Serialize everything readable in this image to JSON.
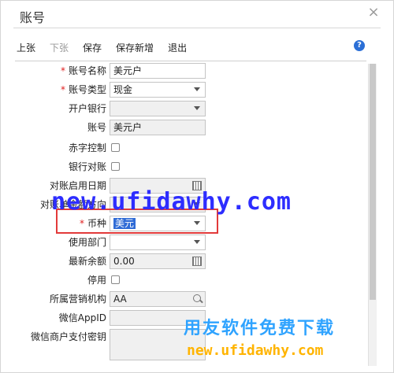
{
  "dialog": {
    "title": "账号",
    "close_glyph": "×"
  },
  "toolbar": {
    "prev": "上张",
    "next": "下张",
    "save": "保存",
    "save_new": "保存新增",
    "exit": "退出",
    "help_glyph": "?"
  },
  "form": {
    "account_name": {
      "label": "账号名称",
      "required_mark": "*",
      "value": "美元户"
    },
    "account_type": {
      "label": "账号类型",
      "required_mark": "*",
      "value": "现金"
    },
    "bank": {
      "label": "开户银行",
      "value": ""
    },
    "account_no": {
      "label": "账号",
      "value": "美元户"
    },
    "red_control": {
      "label": "赤字控制"
    },
    "bank_reconcile": {
      "label": "银行对账"
    },
    "reconcile_date": {
      "label": "对账启用日期",
      "value": ""
    },
    "reconcile_direction": {
      "label": "对账单余额方向",
      "value": ""
    },
    "currency": {
      "label": "币种",
      "required_mark": "*",
      "value": "美元"
    },
    "department": {
      "label": "使用部门",
      "value": ""
    },
    "balance": {
      "label": "最新余额",
      "value": "0.00"
    },
    "disabled": {
      "label": "停用"
    },
    "org": {
      "label": "所属营销机构",
      "value": "AA"
    },
    "wechat_appid": {
      "label": "微信AppID",
      "value": ""
    },
    "wechat_key": {
      "label": "微信商户支付密钥",
      "value": ""
    }
  },
  "watermark": {
    "url_big": "new.ufidawhy.com",
    "cn": "用友软件免费下载",
    "url_small": "new.ufidawhy.com"
  },
  "colors": {
    "required": "#e02020",
    "highlight": "#e23a3a",
    "accent": "#2b6fd6"
  }
}
